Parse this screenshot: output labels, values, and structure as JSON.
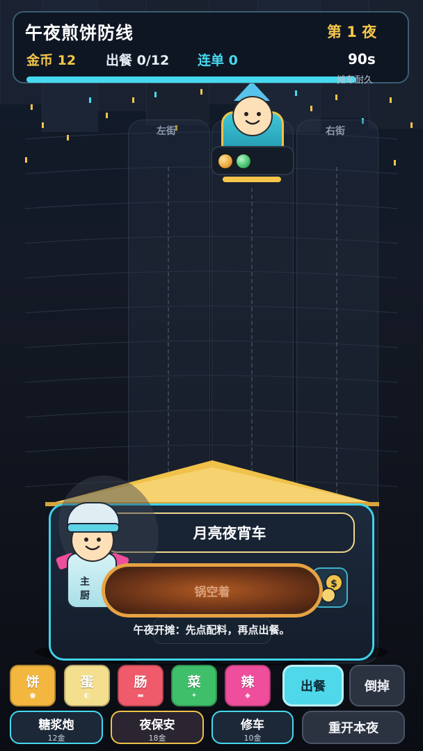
{
  "hud": {
    "title": "午夜煎饼防线",
    "night": "第 1 夜",
    "coins": "金币 12",
    "served": "出餐 0/12",
    "combo": "连单 0",
    "time": "90s",
    "durability_label": "摊车耐久",
    "durability_fraction": 1.0
  },
  "lanes": {
    "left": "左街",
    "right": "右街"
  },
  "customer": {
    "patience_fraction": 1.0,
    "order_colors": [
      "#e9a53a",
      "#3fbf6a"
    ]
  },
  "cart": {
    "sign": "月亮夜宵车",
    "chef_label": "主厨",
    "pan_status": "锅空着",
    "hint": "午夜开摊：先点配料，再点出餐。"
  },
  "ingredients": [
    {
      "label": "饼",
      "glyph": "●",
      "color": "#f3b73f"
    },
    {
      "label": "蛋",
      "glyph": "◐",
      "color": "#f4df8f"
    },
    {
      "label": "肠",
      "glyph": "▬",
      "color": "#ef5b6a"
    },
    {
      "label": "菜",
      "glyph": "✦",
      "color": "#3fbf6a"
    },
    {
      "label": "辣",
      "glyph": "◆",
      "color": "#ee4e9b"
    }
  ],
  "actions": {
    "serve": "出餐",
    "discard": "倒掉",
    "restart": "重开本夜"
  },
  "shop": [
    {
      "name": "糖浆炮",
      "price": "12金",
      "border": "#46d9ef"
    },
    {
      "name": "夜保安",
      "price": "18金",
      "border": "#f0c24a"
    },
    {
      "name": "修车",
      "price": "10金",
      "border": "#46d9ef"
    }
  ]
}
